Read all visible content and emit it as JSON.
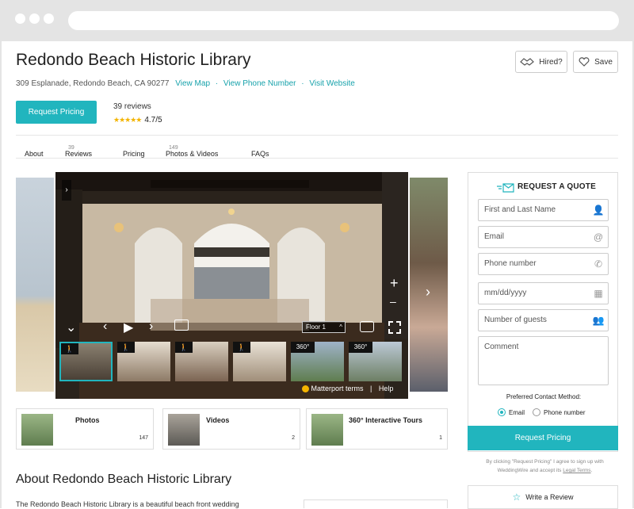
{
  "header": {
    "title": "Redondo Beach Historic Library",
    "address": "309 Esplanade, Redondo Beach, CA 90277",
    "links": [
      "View Map",
      "View Phone Number",
      "Visit Website"
    ],
    "hired_label": "Hired?",
    "save_label": "Save",
    "request_pricing": "Request Pricing",
    "reviews_count": "39 reviews",
    "rating": "4.7/5",
    "rating_value": 4.7
  },
  "nav": {
    "items": [
      {
        "label": "About",
        "count": ""
      },
      {
        "label": "Reviews",
        "count": "39"
      },
      {
        "label": "Pricing",
        "count": ""
      },
      {
        "label": "Photos & Videos",
        "count": "149"
      },
      {
        "label": "FAQs",
        "count": ""
      }
    ]
  },
  "tour": {
    "floor_select": "Floor 1",
    "terms_label": "Matterport terms",
    "help_label": "Help",
    "badge_360": "360°"
  },
  "media_cards": [
    {
      "label": "Photos",
      "count": "147"
    },
    {
      "label": "Videos",
      "count": "2"
    },
    {
      "label": "360° Interactive Tours",
      "count": "1"
    }
  ],
  "about": {
    "heading": "About Redondo Beach Historic Library",
    "text": "The Redondo Beach Historic Library is a beautiful beach front wedding"
  },
  "quote": {
    "title": "REQUEST A QUOTE",
    "fields": [
      {
        "placeholder": "First and Last Name",
        "icon": "person-icon"
      },
      {
        "placeholder": "Email",
        "icon": "at-icon"
      },
      {
        "placeholder": "Phone number",
        "icon": "phone-icon"
      },
      {
        "placeholder": "mm/dd/yyyy",
        "icon": "calendar-icon"
      },
      {
        "placeholder": "Number of guests",
        "icon": "guests-icon"
      },
      {
        "placeholder": "Comment",
        "icon": ""
      }
    ],
    "preferred_contact_label": "Preferred Contact Method:",
    "contact_options": [
      "Email",
      "Phone number"
    ],
    "selected_contact": "Email",
    "submit": "Request Pricing",
    "terms_text": "By clicking \"Request Pricing\" I agree to sign up with WeddingWire and accept its",
    "legal_terms": "Legal Terms",
    "write_review": "Write a Review"
  },
  "colors": {
    "accent": "#21b5be",
    "link": "#17a2ab",
    "star": "#f3b400"
  }
}
